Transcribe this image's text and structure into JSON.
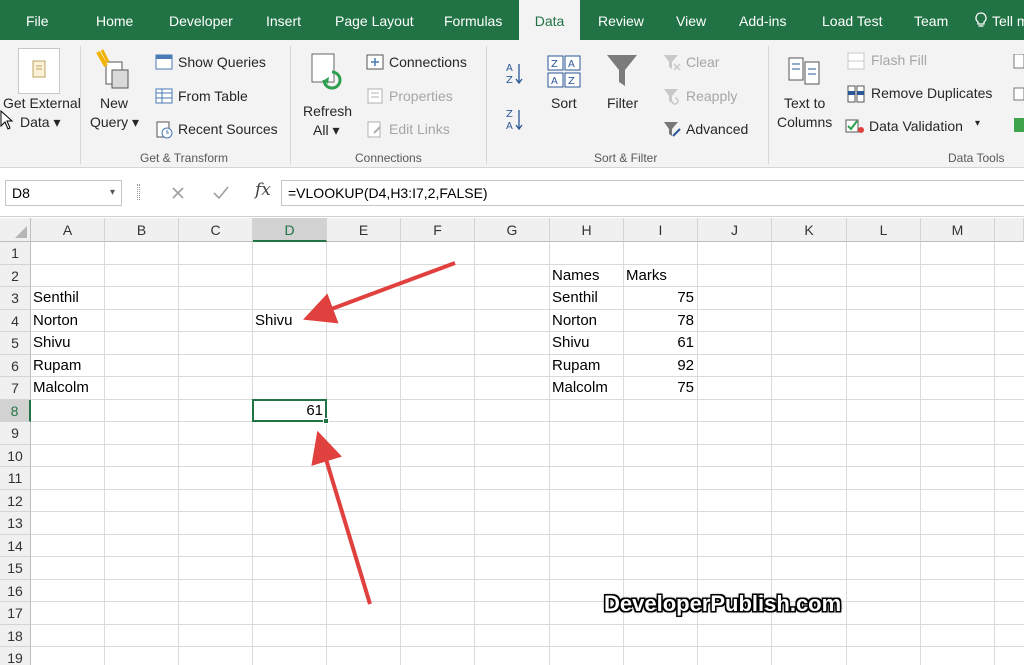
{
  "tabs": [
    "File",
    "Home",
    "Developer",
    "Insert",
    "Page Layout",
    "Formulas",
    "Data",
    "Review",
    "View",
    "Add-ins",
    "Load Test",
    "Team",
    "Tell m"
  ],
  "active_tab": "Data",
  "ribbon": {
    "get_external_data": [
      "Get External",
      "Data ▾"
    ],
    "new_query": [
      "New",
      "Query ▾"
    ],
    "show_queries": "Show Queries",
    "from_table": "From Table",
    "recent_sources": "Recent Sources",
    "refresh_all": [
      "Refresh",
      "All ▾"
    ],
    "connections": "Connections",
    "properties": "Properties",
    "edit_links": "Edit Links",
    "sort": "Sort",
    "filter": "Filter",
    "clear": "Clear",
    "reapply": "Reapply",
    "advanced": "Advanced",
    "text_to_columns": [
      "Text to",
      "Columns"
    ],
    "flash_fill": "Flash Fill",
    "remove_duplicates": "Remove Duplicates",
    "data_validation": "Data Validation",
    "groups": {
      "get_transform": "Get & Transform",
      "connections": "Connections",
      "sort_filter": "Sort & Filter",
      "data_tools": "Data Tools"
    }
  },
  "formula_bar": {
    "name_box": "D8",
    "formula": "=VLOOKUP(D4,H3:I7,2,FALSE)"
  },
  "columns": [
    "A",
    "B",
    "C",
    "D",
    "E",
    "F",
    "G",
    "H",
    "I",
    "J",
    "K",
    "L",
    "M"
  ],
  "rows": [
    "1",
    "2",
    "3",
    "4",
    "5",
    "6",
    "7",
    "8",
    "9",
    "10",
    "11",
    "12",
    "13",
    "14",
    "15",
    "16",
    "17",
    "18",
    "19"
  ],
  "selected_column": "D",
  "selected_row": "8",
  "cells": {
    "A3": "Senthil",
    "A4": "Norton",
    "A5": "Shivu",
    "A6": "Rupam",
    "A7": "Malcolm",
    "D4": "Shivu",
    "D8": "61",
    "H2": "Names",
    "I2": "Marks",
    "H3": "Senthil",
    "I3": "75",
    "H4": "Norton",
    "I4": "78",
    "H5": "Shivu",
    "I5": "61",
    "H6": "Rupam",
    "I6": "92",
    "H7": "Malcolm",
    "I7": "75"
  },
  "watermark": "DeveloperPublish.com",
  "colors": {
    "excel_green": "#217346",
    "arrow_red": "#e0413f"
  }
}
